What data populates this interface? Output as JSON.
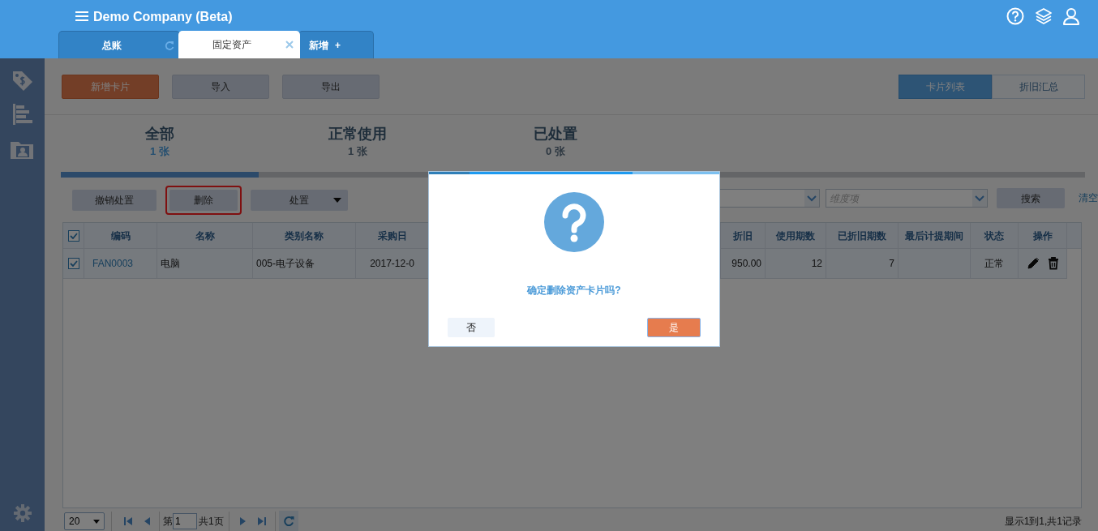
{
  "header": {
    "title": "Demo Company (Beta)"
  },
  "tabs": [
    {
      "label": "总账",
      "selected": false,
      "kind": "refresh"
    },
    {
      "label": "固定资产",
      "selected": true,
      "kind": "close"
    },
    {
      "label": "新增",
      "selected": false,
      "kind": "add",
      "symbol": "+"
    }
  ],
  "toolbar": {
    "buttons": [
      {
        "label": "新增卡片",
        "kind": "primary"
      },
      {
        "label": "导入",
        "kind": "default"
      },
      {
        "label": "导出",
        "kind": "default"
      }
    ],
    "views": [
      {
        "label": "卡片列表",
        "selected": true
      },
      {
        "label": "折旧汇总",
        "selected": false
      }
    ]
  },
  "summary_tabs": [
    {
      "title": "全部",
      "count": "1 张",
      "selected": true
    },
    {
      "title": "正常使用",
      "count": "1 张",
      "selected": false
    },
    {
      "title": "已处置",
      "count": "0 张",
      "selected": false
    }
  ],
  "actions": [
    {
      "label": "撤销处置",
      "kind": "button",
      "highlighted": false
    },
    {
      "label": "删除",
      "kind": "button",
      "highlighted": true
    },
    {
      "label": "处置",
      "kind": "dropdown",
      "highlighted": false
    }
  ],
  "filters": {
    "dimension_placeholder": "维度项",
    "search_button": "搜索",
    "clear_link": "清空"
  },
  "table": {
    "all_checked": true,
    "columns": [
      "编码",
      "名称",
      "类别名称",
      "采购日",
      "折旧",
      "使用期数",
      "已折旧期数",
      "最后计提期间",
      "状态",
      "操作"
    ],
    "rows": [
      {
        "checked": true,
        "cells": [
          "FAN0003",
          "电脑",
          "005-电子设备",
          "2017-12-0",
          "950.00",
          "12",
          "7",
          "",
          "正常"
        ]
      }
    ]
  },
  "pager": {
    "page_size": "20",
    "page_label": "第",
    "page": "1",
    "total_pages": "共1页",
    "summary": "显示1到1,共1记录"
  },
  "dialog": {
    "message": "确定删除资产卡片吗?",
    "buttons": [
      {
        "label": "否",
        "kind": "cancel"
      },
      {
        "label": "是",
        "kind": "confirm"
      }
    ]
  }
}
